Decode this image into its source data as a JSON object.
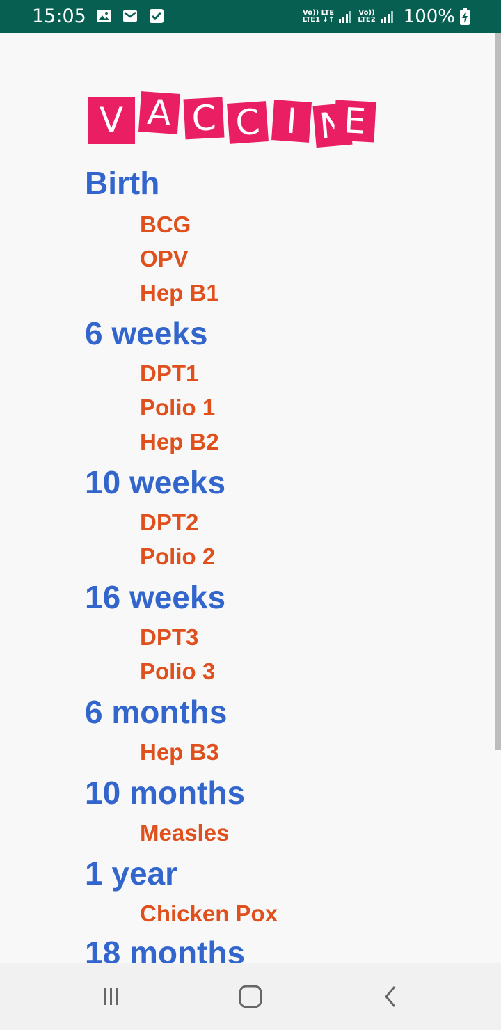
{
  "status_bar": {
    "time": "15:05",
    "sim1_label_top": "Vo)) LTE",
    "sim1_label_bottom": "LTE1 ↓↑",
    "sim2_label_top": "Vo))",
    "sim2_label_bottom": "LTE2",
    "battery": "100%"
  },
  "logo_letters": [
    "V",
    "A",
    "C",
    "C",
    "I",
    "N",
    "E"
  ],
  "schedule": {
    "birth": {
      "age": "Birth",
      "vaccines": [
        "BCG",
        "OPV",
        "Hep B1"
      ]
    },
    "six_weeks": {
      "age": "6 weeks",
      "vaccines": [
        "DPT1",
        "Polio 1",
        "Hep B2"
      ]
    },
    "ten_weeks": {
      "age": "10 weeks",
      "vaccines": [
        "DPT2",
        "Polio 2"
      ]
    },
    "sixteen_weeks": {
      "age": "16 weeks",
      "vaccines": [
        "DPT3",
        "Polio 3"
      ]
    },
    "six_months": {
      "age": "6 months",
      "vaccines": [
        "Hep B3"
      ]
    },
    "ten_months": {
      "age": "10 months",
      "vaccines": [
        "Measles"
      ]
    },
    "one_year": {
      "age": "1 year",
      "vaccines": [
        "Chicken Pox"
      ]
    },
    "eighteen_months": {
      "age": "18 months"
    }
  },
  "colors": {
    "status_bar": "#075f52",
    "logo_tile": "#e91e63",
    "age_heading": "#3366cc",
    "vaccine_name": "#e0501d",
    "background": "#f8f8f8"
  },
  "nav_bar": {
    "icons": [
      "recent-apps-icon",
      "home-icon",
      "back-icon"
    ]
  }
}
